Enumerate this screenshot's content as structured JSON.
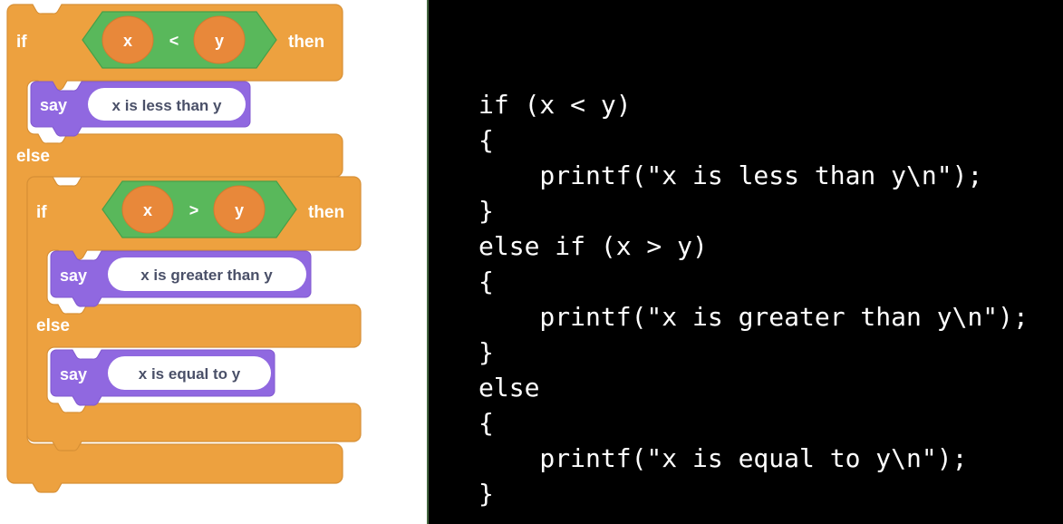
{
  "blocks": {
    "outer_if": {
      "if_label": "if",
      "then_label": "then",
      "else_label": "else",
      "condition": {
        "left": "x",
        "operator": "<",
        "right": "y"
      },
      "color": "#eda13f",
      "color_edge": "#d79036"
    },
    "inner_if": {
      "if_label": "if",
      "then_label": "then",
      "else_label": "else",
      "condition": {
        "left": "x",
        "operator": ">",
        "right": "y"
      },
      "color": "#eda13f",
      "color_edge": "#d79036"
    },
    "say_blocks": [
      {
        "label": "say",
        "message": "x is less than y"
      },
      {
        "label": "say",
        "message": "x is greater than y"
      },
      {
        "label": "say",
        "message": "x is equal to y"
      }
    ],
    "colors": {
      "control_orange": "#eda13f",
      "control_orange_edge": "#d79036",
      "operator_green": "#59b85b",
      "operator_green_edge": "#46a049",
      "variable_orange": "#e8883a",
      "looks_purple": "#9068e0",
      "input_white": "#ffffff",
      "input_text": "#4a5068",
      "block_text": "#ffffff",
      "divider_green": "#44663f",
      "terminal_bg": "#000000",
      "terminal_fg": "#ffffff"
    }
  },
  "code": {
    "language": "c",
    "lines": [
      "if (x < y)",
      "{",
      "    printf(\"x is less than y\\n\");",
      "}",
      "else if (x > y)",
      "{",
      "    printf(\"x is greater than y\\n\");",
      "}",
      "else",
      "{",
      "    printf(\"x is equal to y\\n\");",
      "}"
    ],
    "text": "if (x < y)\n{\n    printf(\"x is less than y\\n\");\n}\nelse if (x > y)\n{\n    printf(\"x is greater than y\\n\");\n}\nelse\n{\n    printf(\"x is equal to y\\n\");\n}"
  }
}
